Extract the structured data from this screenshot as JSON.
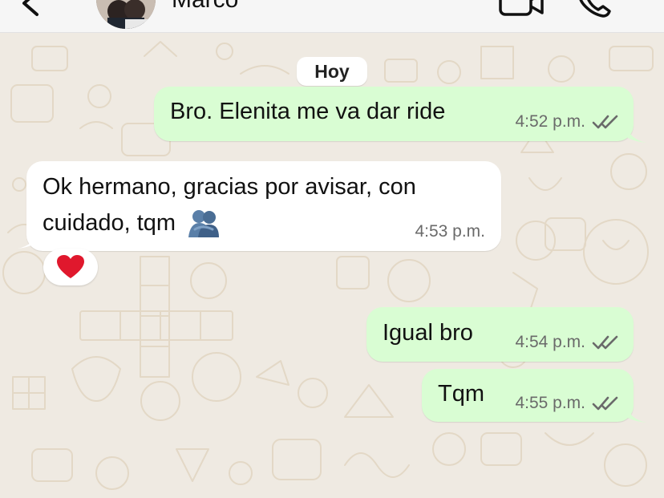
{
  "header": {
    "contact_name": "Marco",
    "back_icon": "chevron-left-icon",
    "video_icon": "video-camera-icon",
    "call_icon": "phone-icon"
  },
  "date_separator": "Hoy",
  "messages": [
    {
      "direction": "out",
      "text": "Bro. Elenita me va dar ride",
      "time": "4:52 p.m.",
      "status": "read"
    },
    {
      "direction": "in",
      "lines": [
        "Ok hermano, gracias por avisar, con",
        "cuidado, tqm"
      ],
      "emoji": "people-hugging",
      "time": "4:53 p.m.",
      "reaction": "red-heart"
    },
    {
      "direction": "out",
      "text": "Igual bro",
      "time": "4:54 p.m.",
      "status": "read"
    },
    {
      "direction": "out",
      "text": "Tqm",
      "time": "4:55 p.m.",
      "status": "read"
    }
  ],
  "colors": {
    "background": "#efeae2",
    "outgoing_bubble": "#d9fdd3",
    "incoming_bubble": "#ffffff",
    "read_ticks": "#6a6a6a",
    "heart": "#e0182d"
  }
}
